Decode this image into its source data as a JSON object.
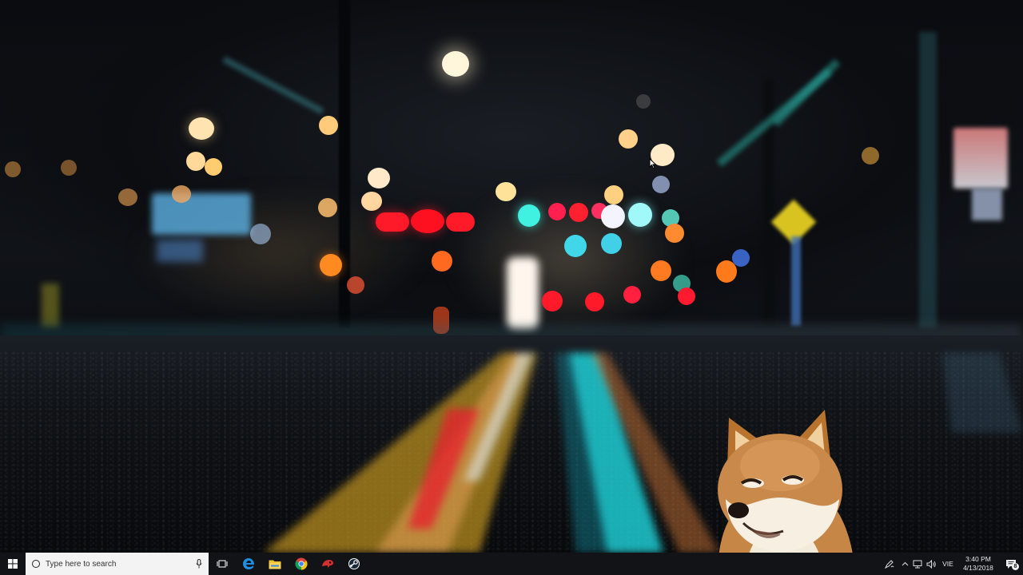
{
  "taskbar": {
    "search": {
      "placeholder": "Type here to search"
    },
    "apps": [
      {
        "name": "task-view-icon"
      },
      {
        "name": "edge-icon"
      },
      {
        "name": "file-explorer-icon"
      },
      {
        "name": "chrome-icon"
      },
      {
        "name": "red-app-icon"
      },
      {
        "name": "steam-icon"
      }
    ],
    "tray": {
      "language": "VIE",
      "time": "3:40 PM",
      "date": "4/13/2018",
      "notification_count": "8"
    }
  },
  "colors": {
    "taskbar": "#121418",
    "search_box": "#f3f3f3",
    "edge_blue": "#1e8fe0",
    "folder_yellow": "#f1c232"
  }
}
